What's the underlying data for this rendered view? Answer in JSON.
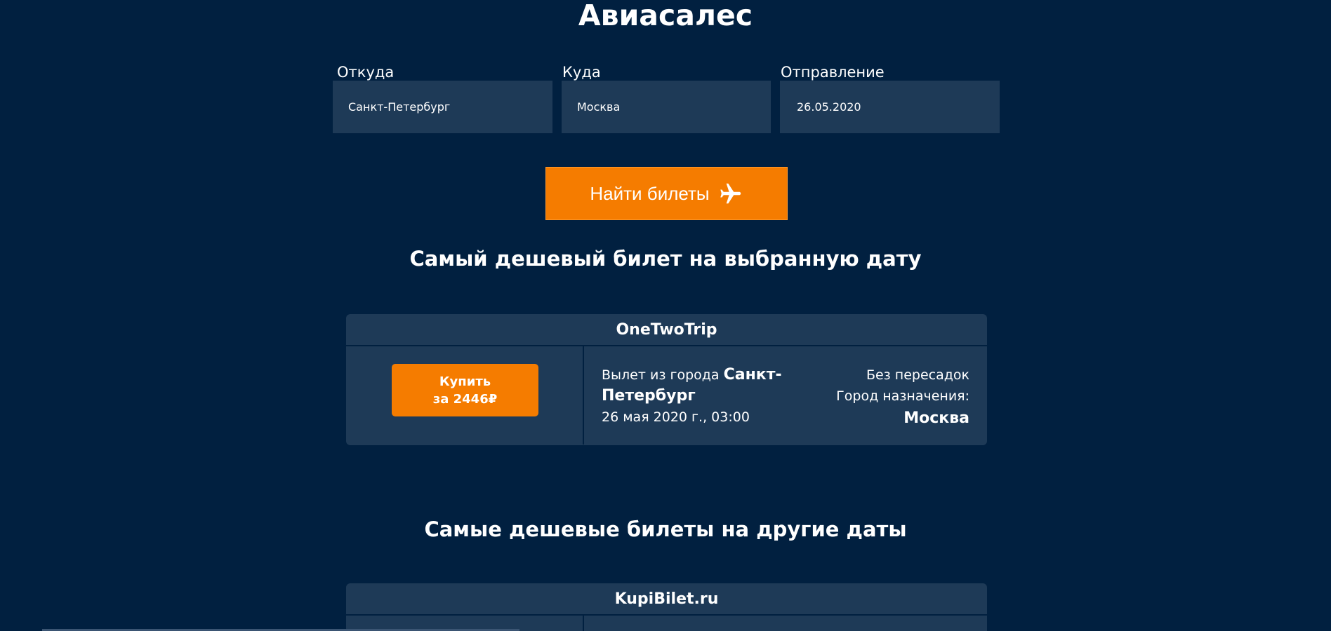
{
  "app": {
    "title": "Авиасалес"
  },
  "search": {
    "from_label": "Откуда",
    "from_value": "Санкт-Петербург",
    "to_label": "Куда",
    "to_value": "Москва",
    "date_label": "Отправление",
    "date_value": "26.05.2020",
    "button_label": "Найти билеты",
    "button_icon": "airplane-icon"
  },
  "cheapest_section": {
    "title": "Самый дешевый билет на выбранную дату",
    "ticket": {
      "agency": "OneTwoTrip",
      "buy_line1": "Купить",
      "buy_line2": "за 2446₽",
      "depart_prefix": "Вылет из города",
      "depart_city": "Санкт-Петербург",
      "depart_datetime": "26 мая 2020 г., 03:00",
      "transfers": "Без пересадок",
      "destination_label": "Город назначения:",
      "destination_city": "Москва"
    }
  },
  "other_dates_section": {
    "title": "Самые дешевые билеты на другие даты",
    "ticket": {
      "agency": "KupiBilet.ru"
    }
  },
  "colors": {
    "background": "#012040",
    "card": "#1e3a57",
    "accent": "#f57c00",
    "text": "#ffffff"
  }
}
